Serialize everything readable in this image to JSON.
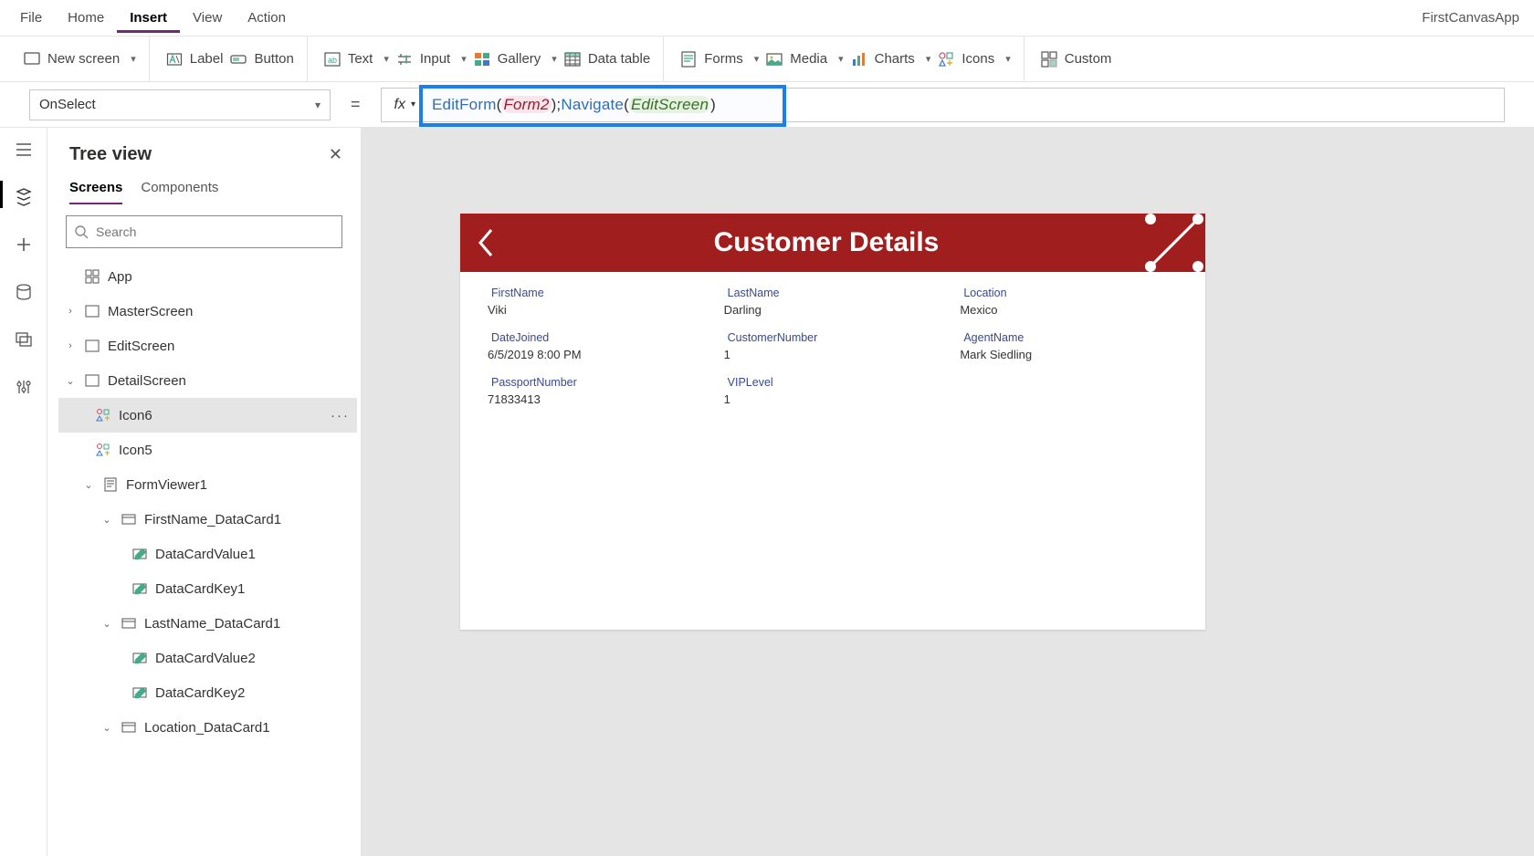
{
  "app_title": "FirstCanvasApp",
  "menu": {
    "file": "File",
    "home": "Home",
    "insert": "Insert",
    "view": "View",
    "action": "Action",
    "active": "Insert"
  },
  "ribbon": {
    "newscreen": "New screen",
    "label": "Label",
    "button": "Button",
    "text": "Text",
    "input": "Input",
    "gallery": "Gallery",
    "datatable": "Data table",
    "forms": "Forms",
    "media": "Media",
    "charts": "Charts",
    "icons": "Icons",
    "custom": "Custom"
  },
  "formula": {
    "property": "OnSelect",
    "fx": "fx",
    "fn1": "EditForm",
    "arg1": "Form2",
    "fn2": "Navigate",
    "arg2": "EditScreen"
  },
  "panel": {
    "title": "Tree view",
    "tab_screens": "Screens",
    "tab_components": "Components",
    "search_placeholder": "Search"
  },
  "tree": {
    "app": "App",
    "master": "MasterScreen",
    "edit": "EditScreen",
    "detail": "DetailScreen",
    "icon6": "Icon6",
    "icon5": "Icon5",
    "formviewer": "FormViewer1",
    "fn_card": "FirstName_DataCard1",
    "dcv1": "DataCardValue1",
    "dck1": "DataCardKey1",
    "ln_card": "LastName_DataCard1",
    "dcv2": "DataCardValue2",
    "dck2": "DataCardKey2",
    "loc_card": "Location_DataCard1"
  },
  "details": {
    "title": "Customer Details",
    "fields": {
      "FirstName": {
        "label": "FirstName",
        "value": "Viki"
      },
      "LastName": {
        "label": "LastName",
        "value": "Darling"
      },
      "Location": {
        "label": "Location",
        "value": "Mexico"
      },
      "DateJoined": {
        "label": "DateJoined",
        "value": "6/5/2019 8:00 PM"
      },
      "CustomerNumber": {
        "label": "CustomerNumber",
        "value": "1"
      },
      "AgentName": {
        "label": "AgentName",
        "value": "Mark Siedling"
      },
      "PassportNumber": {
        "label": "PassportNumber",
        "value": "71833413"
      },
      "VIPLevel": {
        "label": "VIPLevel",
        "value": "1"
      }
    }
  }
}
